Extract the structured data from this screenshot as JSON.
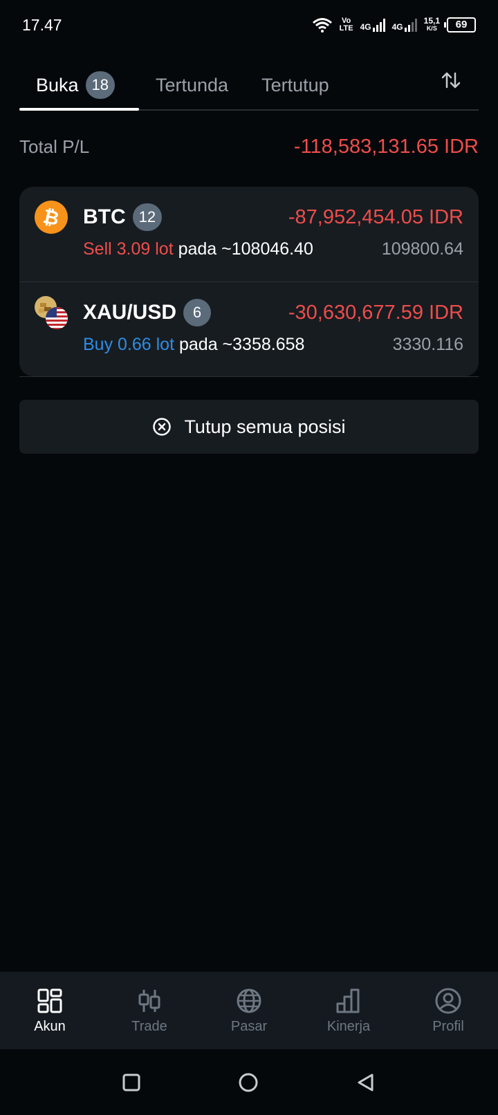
{
  "status_bar": {
    "time": "17.47",
    "volte_top": "Vo",
    "volte_bottom": "LTE",
    "net1": "4G",
    "net2": "4G",
    "speed_top": "15,1",
    "speed_bottom": "K/S",
    "battery": "69"
  },
  "tabs": [
    {
      "label": "Buka",
      "count": "18",
      "active": true
    },
    {
      "label": "Tertunda",
      "active": false
    },
    {
      "label": "Tertutup",
      "active": false
    }
  ],
  "sort_icon": "sort-arrows-icon",
  "total": {
    "label": "Total P/L",
    "value": "-118,583,131.65 IDR"
  },
  "positions": [
    {
      "symbol": "BTC",
      "count": "12",
      "pl": "-87,952,454.05 IDR",
      "side": "Sell 3.09 lot",
      "at": "pada ~108046.40",
      "current": "109800.64",
      "icon": "bitcoin-icon"
    },
    {
      "symbol": "XAU/USD",
      "count": "6",
      "pl": "-30,630,677.59 IDR",
      "side": "Buy 0.66 lot",
      "at": "pada ~3358.658",
      "current": "3330.116",
      "icon": "gold-usd-icon"
    }
  ],
  "close_all": {
    "label": "Tutup semua posisi",
    "icon": "close-circle-icon"
  },
  "bottom_nav": [
    {
      "label": "Akun",
      "icon": "account-grid-icon",
      "active": true
    },
    {
      "label": "Trade",
      "icon": "candlestick-icon",
      "active": false
    },
    {
      "label": "Pasar",
      "icon": "globe-icon",
      "active": false
    },
    {
      "label": "Kinerja",
      "icon": "bar-chart-icon",
      "active": false
    },
    {
      "label": "Profil",
      "icon": "profile-icon",
      "active": false
    }
  ],
  "colors": {
    "background": "#05080b",
    "card": "#171c21",
    "loss": "#ef4d4a",
    "buy": "#2f8de4",
    "muted": "#9aa1a9",
    "badge": "#5b6b7a",
    "bitcoin": "#f7931a"
  }
}
